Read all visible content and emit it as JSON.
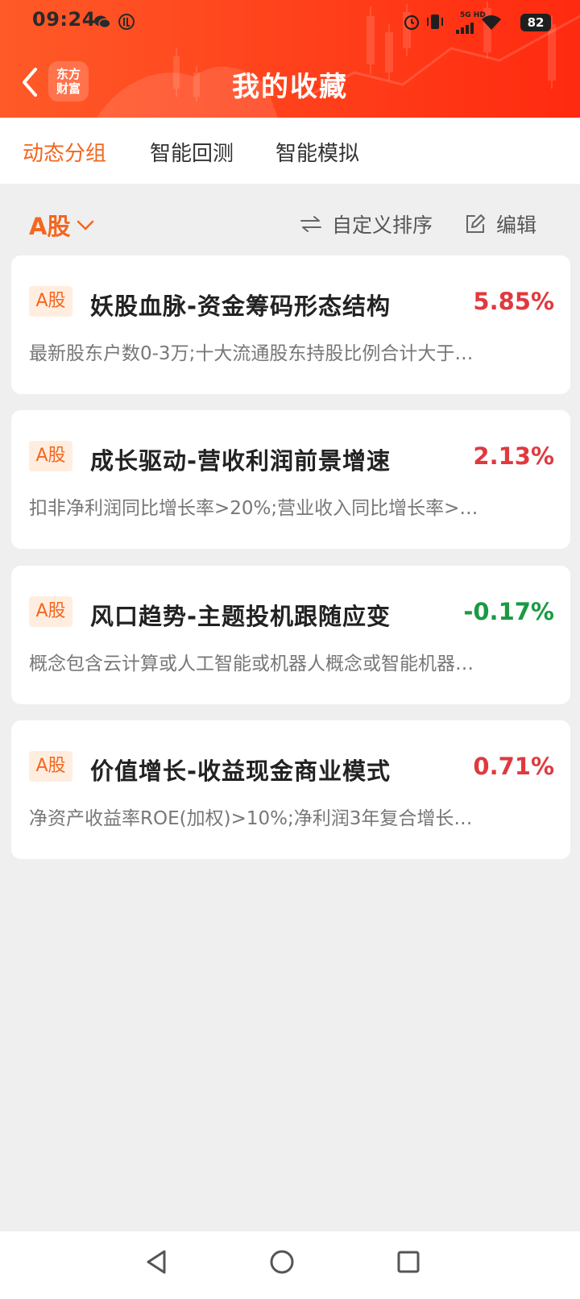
{
  "status_bar": {
    "time": "09:24",
    "network": "5G HD",
    "battery": "82"
  },
  "header": {
    "title": "我的收藏",
    "logo_line1": "东方",
    "logo_line2": "财富"
  },
  "tabs": [
    {
      "label": "动态分组",
      "active": true
    },
    {
      "label": "智能回测",
      "active": false
    },
    {
      "label": "智能模拟",
      "active": false
    }
  ],
  "toolbar": {
    "market": "A股",
    "sort_label": "自定义排序",
    "edit_label": "编辑"
  },
  "cards": [
    {
      "badge": "A股",
      "title": "妖股血脉-资金筹码形态结构",
      "change": "5.85%",
      "desc": "最新股东户数0-3万;十大流通股东持股比例合计大于…"
    },
    {
      "badge": "A股",
      "title": "成长驱动-营收利润前景增速",
      "change": "2.13%",
      "desc": "扣非净利润同比增长率>20%;营业收入同比增长率>…"
    },
    {
      "badge": "A股",
      "title": "风口趋势-主题投机跟随应变",
      "change": "-0.17%",
      "desc": "概念包含云计算或人工智能或机器人概念或智能机器…"
    },
    {
      "badge": "A股",
      "title": "价值增长-收益现金商业模式",
      "change": "0.71%",
      "desc": "净资产收益率ROE(加权)>10%;净利润3年复合增长…"
    }
  ],
  "colors": {
    "accent": "#f4661f",
    "up": "#e0393e",
    "down": "#1a9a43"
  }
}
